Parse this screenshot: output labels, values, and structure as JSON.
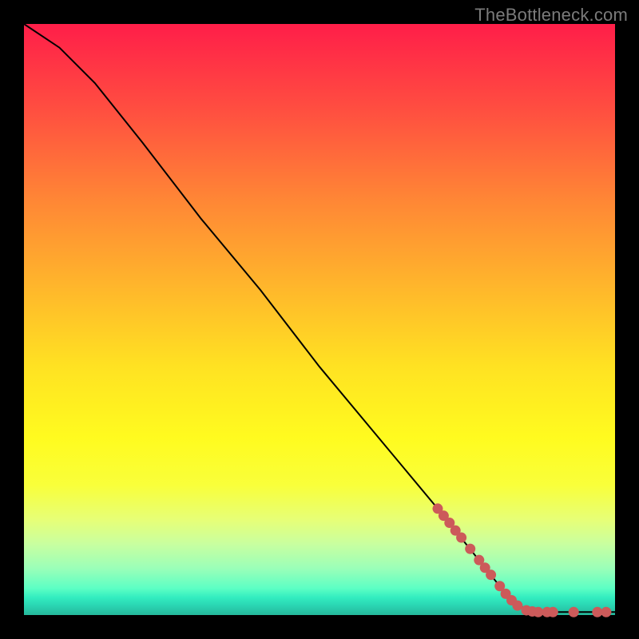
{
  "watermark": "TheBottleneck.com",
  "chart_data": {
    "type": "line",
    "title": "",
    "xlabel": "",
    "ylabel": "",
    "xlim": [
      0,
      100
    ],
    "ylim": [
      0,
      100
    ],
    "grid": false,
    "series": [
      {
        "name": "curve",
        "points": [
          {
            "x": 0,
            "y": 100
          },
          {
            "x": 6,
            "y": 96
          },
          {
            "x": 12,
            "y": 90
          },
          {
            "x": 20,
            "y": 80
          },
          {
            "x": 30,
            "y": 67
          },
          {
            "x": 40,
            "y": 55
          },
          {
            "x": 50,
            "y": 42
          },
          {
            "x": 60,
            "y": 30
          },
          {
            "x": 70,
            "y": 18
          },
          {
            "x": 78,
            "y": 8
          },
          {
            "x": 82,
            "y": 3
          },
          {
            "x": 85,
            "y": 0.8
          },
          {
            "x": 90,
            "y": 0.5
          },
          {
            "x": 100,
            "y": 0.5
          }
        ]
      },
      {
        "name": "highlighted_points",
        "points": [
          {
            "x": 70,
            "y": 18
          },
          {
            "x": 71,
            "y": 16.8
          },
          {
            "x": 72,
            "y": 15.6
          },
          {
            "x": 73,
            "y": 14.3
          },
          {
            "x": 74,
            "y": 13.1
          },
          {
            "x": 75.5,
            "y": 11.2
          },
          {
            "x": 77,
            "y": 9.3
          },
          {
            "x": 78,
            "y": 8
          },
          {
            "x": 79,
            "y": 6.8
          },
          {
            "x": 80.5,
            "y": 4.9
          },
          {
            "x": 81.5,
            "y": 3.6
          },
          {
            "x": 82.5,
            "y": 2.5
          },
          {
            "x": 83.5,
            "y": 1.6
          },
          {
            "x": 85,
            "y": 0.8
          },
          {
            "x": 86,
            "y": 0.6
          },
          {
            "x": 87,
            "y": 0.5
          },
          {
            "x": 88.5,
            "y": 0.5
          },
          {
            "x": 89.5,
            "y": 0.5
          },
          {
            "x": 93,
            "y": 0.5
          },
          {
            "x": 97,
            "y": 0.5
          },
          {
            "x": 98.5,
            "y": 0.5
          }
        ]
      }
    ]
  },
  "colors": {
    "background": "#000000",
    "dot": "#cc5a5a",
    "curve": "#000000"
  }
}
